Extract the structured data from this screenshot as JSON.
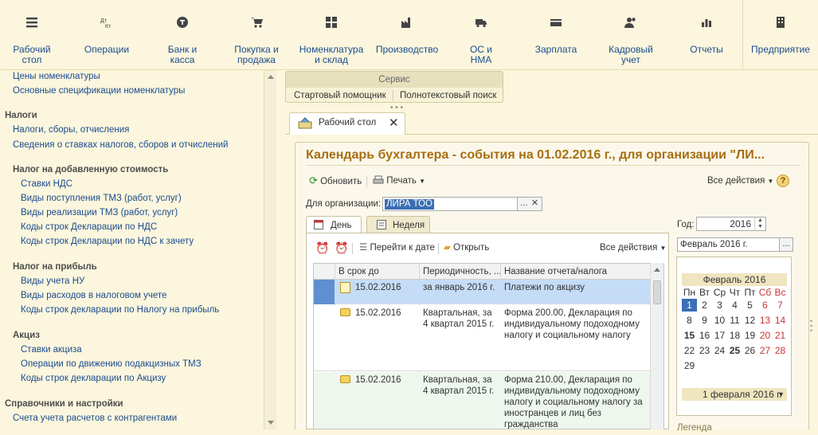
{
  "sections": [
    {
      "label": "Рабочий\nстол",
      "icon": "menu-icon"
    },
    {
      "label": "Операции",
      "icon": "dtkt-icon"
    },
    {
      "label": "Банк и\nкасса",
      "icon": "coin-icon"
    },
    {
      "label": "Покупка и\nпродажа",
      "icon": "cart-icon"
    },
    {
      "label": "Номенклатура\nи склад",
      "icon": "grid-icon"
    },
    {
      "label": "Производство",
      "icon": "factory-icon"
    },
    {
      "label": "ОС и\nНМА",
      "icon": "truck-icon"
    },
    {
      "label": "Зарплата",
      "icon": "wallet-icon"
    },
    {
      "label": "Кадровый\nучет",
      "icon": "people-icon"
    },
    {
      "label": "Отчеты",
      "icon": "barchart-icon"
    },
    {
      "label": "Предприятие",
      "icon": "building-icon"
    }
  ],
  "left_nav": {
    "items": [
      {
        "kind": "li",
        "text": "Цены номенклатуры"
      },
      {
        "kind": "li",
        "text": "Основные спецификации номенклатуры"
      },
      {
        "kind": "gh",
        "text": "Налоги"
      },
      {
        "kind": "li",
        "text": "Налоги, сборы, отчисления"
      },
      {
        "kind": "li",
        "text": "Сведения о ставках налогов, сборов и отчислений"
      },
      {
        "kind": "sub",
        "text": "Налог на добавленную стоимость"
      },
      {
        "kind": "li2",
        "text": "Ставки НДС"
      },
      {
        "kind": "li2",
        "text": "Виды поступления ТМЗ (работ, услуг)"
      },
      {
        "kind": "li2",
        "text": "Виды реализации ТМЗ (работ, услуг)"
      },
      {
        "kind": "li2",
        "text": "Коды строк Декларации по НДС"
      },
      {
        "kind": "li2",
        "text": "Коды строк Декларации по НДС к зачету"
      },
      {
        "kind": "sub",
        "text": "Налог на прибыль"
      },
      {
        "kind": "li2",
        "text": "Виды учета НУ"
      },
      {
        "kind": "li2",
        "text": "Виды расходов в налоговом учете"
      },
      {
        "kind": "li2",
        "text": "Коды строк декларации по Налогу на прибыль"
      },
      {
        "kind": "sub",
        "text": "Акциз"
      },
      {
        "kind": "li2",
        "text": "Ставки акциза"
      },
      {
        "kind": "li2",
        "text": "Операции по движению подакцизных ТМЗ"
      },
      {
        "kind": "li2",
        "text": "Коды строк декларации по Акцизу"
      },
      {
        "kind": "gh",
        "text": "Справочники и настройки"
      },
      {
        "kind": "li",
        "text": "Счета учета расчетов с контрагентами"
      }
    ]
  },
  "service": {
    "title": "Сервис",
    "btn1": "Стартовый помощник",
    "btn2": "Полнотекстовый поиск"
  },
  "tab": {
    "label": "Рабочий стол"
  },
  "content": {
    "title": "Календарь бухгалтера - события на 01.02.2016 г., для организации \"ЛИ...",
    "refresh": "Обновить",
    "print": "Печать",
    "all_actions": "Все действия",
    "help": "?",
    "org_label": "Для организации:",
    "org_value": "ЛИРА ТОО",
    "tab_day": "День",
    "tab_week": "Неделя",
    "goto_date": "Перейти к дате",
    "open": "Открыть",
    "all_actions2": "Все действия",
    "columns": [
      "В срок до",
      "Периодичность, ...",
      "Название отчета/налога"
    ],
    "rows": [
      {
        "date": "15.02.2016",
        "period": "за январь 2016 г.",
        "name": "Платежи по акцизу"
      },
      {
        "date": "15.02.2016",
        "period": "Квартальная, за 4 квартал 2015 г.",
        "name": "Форма 200.00, Декларация по индивидуальному подоходному налогу и социальному налогу"
      },
      {
        "date": "15.02.2016",
        "period": "Квартальная, за 4 квартал 2015 г.",
        "name": "Форма 210.00, Декларация по индивидуальному подоходному налогу и социальному налогу за иностранцев и лиц без гражданства"
      }
    ]
  },
  "calendar": {
    "year_label": "Год:",
    "year": "2016",
    "month_value": "Февраль 2016 г.",
    "month_title": "Февраль 2016",
    "weekdays": [
      "Пн",
      "Вт",
      "Ср",
      "Чт",
      "Пт",
      "Сб",
      "Вс"
    ],
    "weeks": [
      [
        "1",
        "2",
        "3",
        "4",
        "5",
        "6",
        "7"
      ],
      [
        "8",
        "9",
        "10",
        "11",
        "12",
        "13",
        "14"
      ],
      [
        "15",
        "16",
        "17",
        "18",
        "19",
        "20",
        "21"
      ],
      [
        "22",
        "23",
        "24",
        "25",
        "26",
        "27",
        "28"
      ],
      [
        "29",
        "",
        "",
        "",
        "",
        "",
        ""
      ]
    ],
    "footer": "1 февраля 2016 г.",
    "legend": "Легенда",
    "selected": "1",
    "bold_days": [
      "15",
      "25"
    ]
  }
}
